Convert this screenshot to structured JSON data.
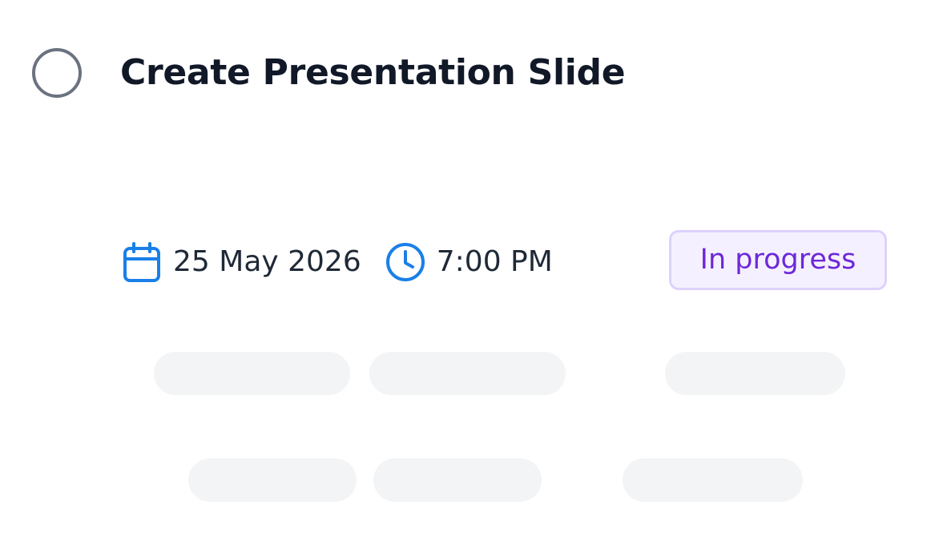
{
  "task": {
    "title": "Create Presentation Slide",
    "date": "25 May 2026",
    "time": "7:00 PM",
    "status": "In progress"
  },
  "icons": {
    "checkbox": "circle-checkbox-icon",
    "date": "calendar-icon",
    "time": "clock-icon"
  },
  "colors": {
    "accent_blue": "#1a7fe8",
    "status_text": "#6d28d9",
    "status_bg": "#f5f0ff",
    "status_border": "#ddd2fb",
    "checkbox_border": "#6b7280",
    "title": "#111827",
    "skeleton": "#f3f4f6"
  }
}
